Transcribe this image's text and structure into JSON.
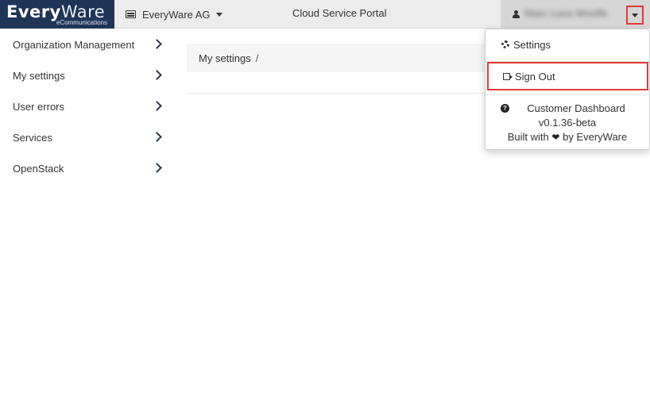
{
  "brand": {
    "logo_main_every": "Every",
    "logo_main_ware": "Ware",
    "logo_sub": "eCommunications",
    "accent": "#1f3557"
  },
  "header": {
    "organization": "EveryWare AG",
    "organization_icon": "list-icon",
    "portal_title": "Cloud Service Portal",
    "user_icon": "user-icon",
    "user_name": "Marc Luca Woolfe"
  },
  "sidebar": {
    "items": [
      {
        "label": "Organization Management",
        "icon": "chevron-right-icon"
      },
      {
        "label": "My settings",
        "icon": "chevron-right-icon"
      },
      {
        "label": "User errors",
        "icon": "chevron-right-icon"
      },
      {
        "label": "Services",
        "icon": "chevron-right-icon"
      },
      {
        "label": "OpenStack",
        "icon": "chevron-right-icon"
      }
    ]
  },
  "breadcrumb": {
    "current": "My settings",
    "separator": "/"
  },
  "user_menu": {
    "settings_label": "Settings",
    "settings_icon": "gear-icon",
    "signout_label": "Sign Out",
    "signout_icon": "sign-out-icon",
    "info_icon": "question-circle-icon",
    "info_title": "Customer Dashboard",
    "version": "v0.1.36-beta",
    "built_with_prefix": "Built with",
    "heart_glyph": "❤",
    "built_with_suffix": "by EveryWare"
  },
  "colors": {
    "highlight": "#e53935",
    "topbar_bg": "#ececec"
  }
}
